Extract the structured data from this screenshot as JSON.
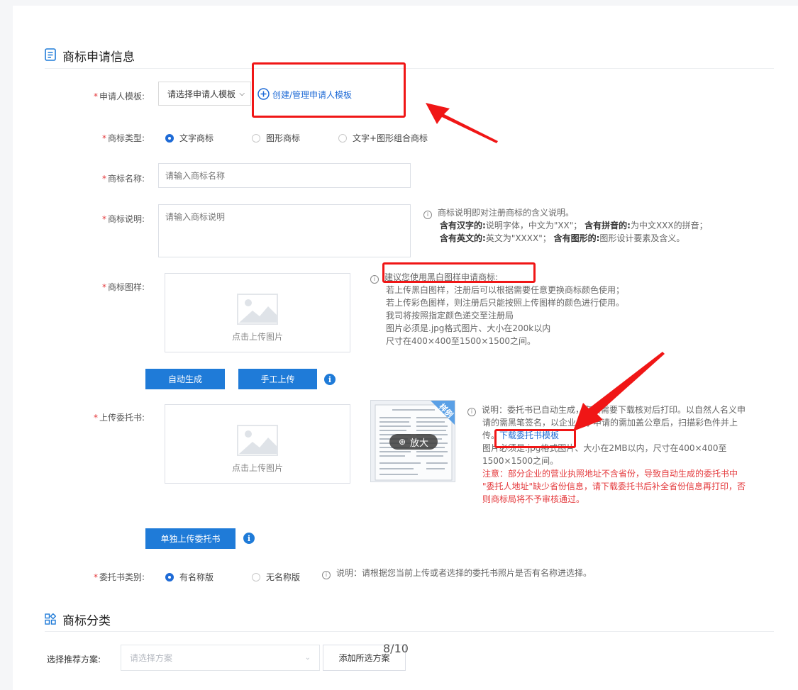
{
  "section1": {
    "title": "商标申请信息"
  },
  "applicant": {
    "label": "申请人模板:",
    "select_value": "请选择申请人模板",
    "create_link": "创建/管理申请人模板"
  },
  "tm_type": {
    "label": "商标类型:",
    "options": [
      "文字商标",
      "图形商标",
      "文字+图形组合商标"
    ],
    "selected_index": 0
  },
  "tm_name": {
    "label": "商标名称:",
    "placeholder": "请输入商标名称"
  },
  "tm_desc": {
    "label": "商标说明:",
    "placeholder": "请输入商标说明",
    "hint_line1": "商标说明即对注册商标的含义说明。",
    "hint_b1": "含有汉字的:",
    "hint_t1": "说明字体，中文为\"XX\"；",
    "hint_b2": "含有拼音的:",
    "hint_t2": "为中文XXX的拼音；",
    "hint_b3": "含有英文的:",
    "hint_t3": "英文为\"XXXX\"；",
    "hint_b4": "含有图形的:",
    "hint_t4": "图形设计要素及含义。"
  },
  "tm_image": {
    "label": "商标图样:",
    "upload_text": "点击上传图片",
    "hint_title": "建议您使用黑白图样申请商标:",
    "hint_lines": [
      "若上传黑白图样，注册后可以根据需要任意更换商标颜色使用；",
      "若上传彩色图样，则注册后只能按照上传图样的颜色进行使用。",
      "我司将按照指定颜色递交至注册局",
      "图片必须是.jpg格式图片、大小在200k以内",
      "尺寸在400×400至1500×1500之间。"
    ],
    "btn_auto": "自动生成",
    "btn_manual": "手工上传"
  },
  "poa": {
    "label": "上传委托书:",
    "upload_text": "点击上传图片",
    "sample_badge": "样例",
    "zoom_label": "放大",
    "hint_line1": "说明：委托书已自动生成，您只需要下载核对后打印。以自然人名义申",
    "hint_line2": "请的需黑笔签名，以企业名字申请的需加盖公章后，扫描彩色件并上",
    "hint_line3_prefix": "传。",
    "download_link": "下载委托书模板",
    "hint_line4": "图片必须是.jpg格式图片、大小在2MB以内，尺寸在400×400至",
    "hint_line5": "1500×1500之间。",
    "warn_line1": "注意：部分企业的营业执照地址不含省份，导致自动生成的委托书中",
    "warn_line2": "\"委托人地址\"缺少省份信息，请下载委托书后补全省份信息再打印，否",
    "warn_line3": "则商标局将不予审核通过。",
    "btn_single": "单独上传委托书"
  },
  "poa_type": {
    "label": "委托书类别:",
    "options": [
      "有名称版",
      "无名称版"
    ],
    "selected_index": 0,
    "hint": "说明：请根据您当前上传或者选择的委托书照片是否有名称进选择。"
  },
  "section2": {
    "title": "商标分类"
  },
  "scheme": {
    "label": "选择推荐方案:",
    "placeholder": "请选择方案",
    "add_button": "添加所选方案"
  },
  "pager": {
    "text": "8/10"
  },
  "colors": {
    "accent": "#1f7bd8",
    "required": "#e4393c",
    "annotation": "#f01616"
  }
}
